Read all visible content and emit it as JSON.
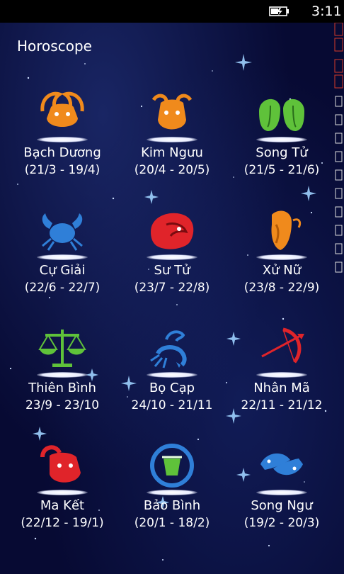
{
  "status": {
    "time": "3:11"
  },
  "app": {
    "title": "Horoscope"
  },
  "signs": [
    {
      "name": "Bạch Dương",
      "dates": "(21/3 - 19/4)",
      "icon": "aries-icon"
    },
    {
      "name": "Kim Ngưu",
      "dates": "(20/4 - 20/5)",
      "icon": "taurus-icon"
    },
    {
      "name": "Song Tử",
      "dates": "(21/5 - 21/6)",
      "icon": "gemini-icon"
    },
    {
      "name": "Cự Giải",
      "dates": "(22/6 - 22/7)",
      "icon": "cancer-icon"
    },
    {
      "name": "Sư Tử",
      "dates": "(23/7 - 22/8)",
      "icon": "leo-icon"
    },
    {
      "name": "Xử Nữ",
      "dates": "(23/8 - 22/9)",
      "icon": "virgo-icon"
    },
    {
      "name": "Thiên Bình",
      "dates": "23/9 - 23/10",
      "icon": "libra-icon"
    },
    {
      "name": "Bọ Cạp",
      "dates": "24/10 - 21/11",
      "icon": "scorpio-icon"
    },
    {
      "name": "Nhân Mã",
      "dates": "22/11 - 21/12",
      "icon": "sagittarius-icon"
    },
    {
      "name": "Ma Kết",
      "dates": "(22/12 - 19/1)",
      "icon": "capricorn-icon"
    },
    {
      "name": "Bảo Bình",
      "dates": "(20/1 - 18/2)",
      "icon": "aquarius-icon"
    },
    {
      "name": "Song Ngư",
      "dates": "(19/2 - 20/3)",
      "icon": "pisces-icon"
    }
  ],
  "colors": {
    "background": "#070a33",
    "orange": "#f08a1c",
    "green": "#5fc23a",
    "blue": "#2f7fd8",
    "red": "#e0242a"
  }
}
